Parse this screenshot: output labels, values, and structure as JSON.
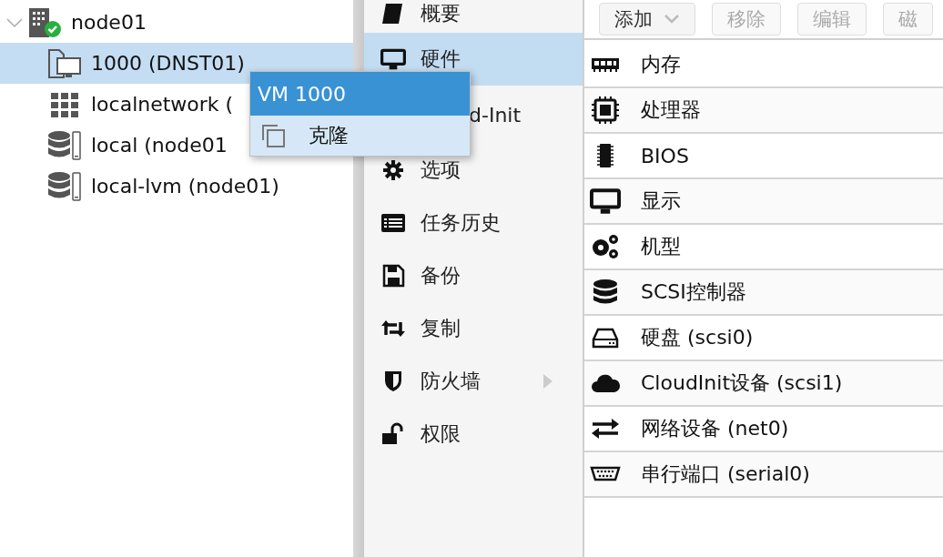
{
  "tree": [
    {
      "label": "node01",
      "expanded": true,
      "selected": false,
      "children": [
        {
          "label": "1000 (DNST01)",
          "selected": true
        },
        {
          "label": "localnetwork (",
          "selected": false
        },
        {
          "label": "local (node01",
          "selected": false
        },
        {
          "label": "local-lvm (node01)",
          "selected": false
        }
      ]
    }
  ],
  "nav": [
    {
      "label": "概要",
      "selected": false
    },
    {
      "label": "硬件",
      "selected": true
    },
    {
      "label": "d-Init",
      "kind": "partial",
      "selected": false
    },
    {
      "label": "选项",
      "selected": false
    },
    {
      "label": "任务历史",
      "selected": false
    },
    {
      "label": "备份",
      "selected": false
    },
    {
      "label": "复制",
      "selected": false
    },
    {
      "label": "防火墙",
      "selected": false,
      "submenu": true
    },
    {
      "label": "权限",
      "selected": false
    }
  ],
  "toolbar": [
    {
      "label": "添加",
      "disabled": false,
      "dropdown": true
    },
    {
      "label": "移除",
      "disabled": true
    },
    {
      "label": "编辑",
      "disabled": true
    },
    {
      "label": "磁",
      "disabled": true
    }
  ],
  "hardware": [
    {
      "label": "内存"
    },
    {
      "label": "处理器"
    },
    {
      "label": "BIOS"
    },
    {
      "label": "显示"
    },
    {
      "label": "机型"
    },
    {
      "label": "SCSI控制器"
    },
    {
      "label": "硬盘 (scsi0)"
    },
    {
      "label": "CloudInit设备 (scsi1)"
    },
    {
      "label": "网络设备 (net0)"
    },
    {
      "label": "串行端口 (serial0)"
    }
  ],
  "context_menu": {
    "title": "VM 1000",
    "items": [
      {
        "label": "克隆",
        "selected": true
      }
    ]
  }
}
